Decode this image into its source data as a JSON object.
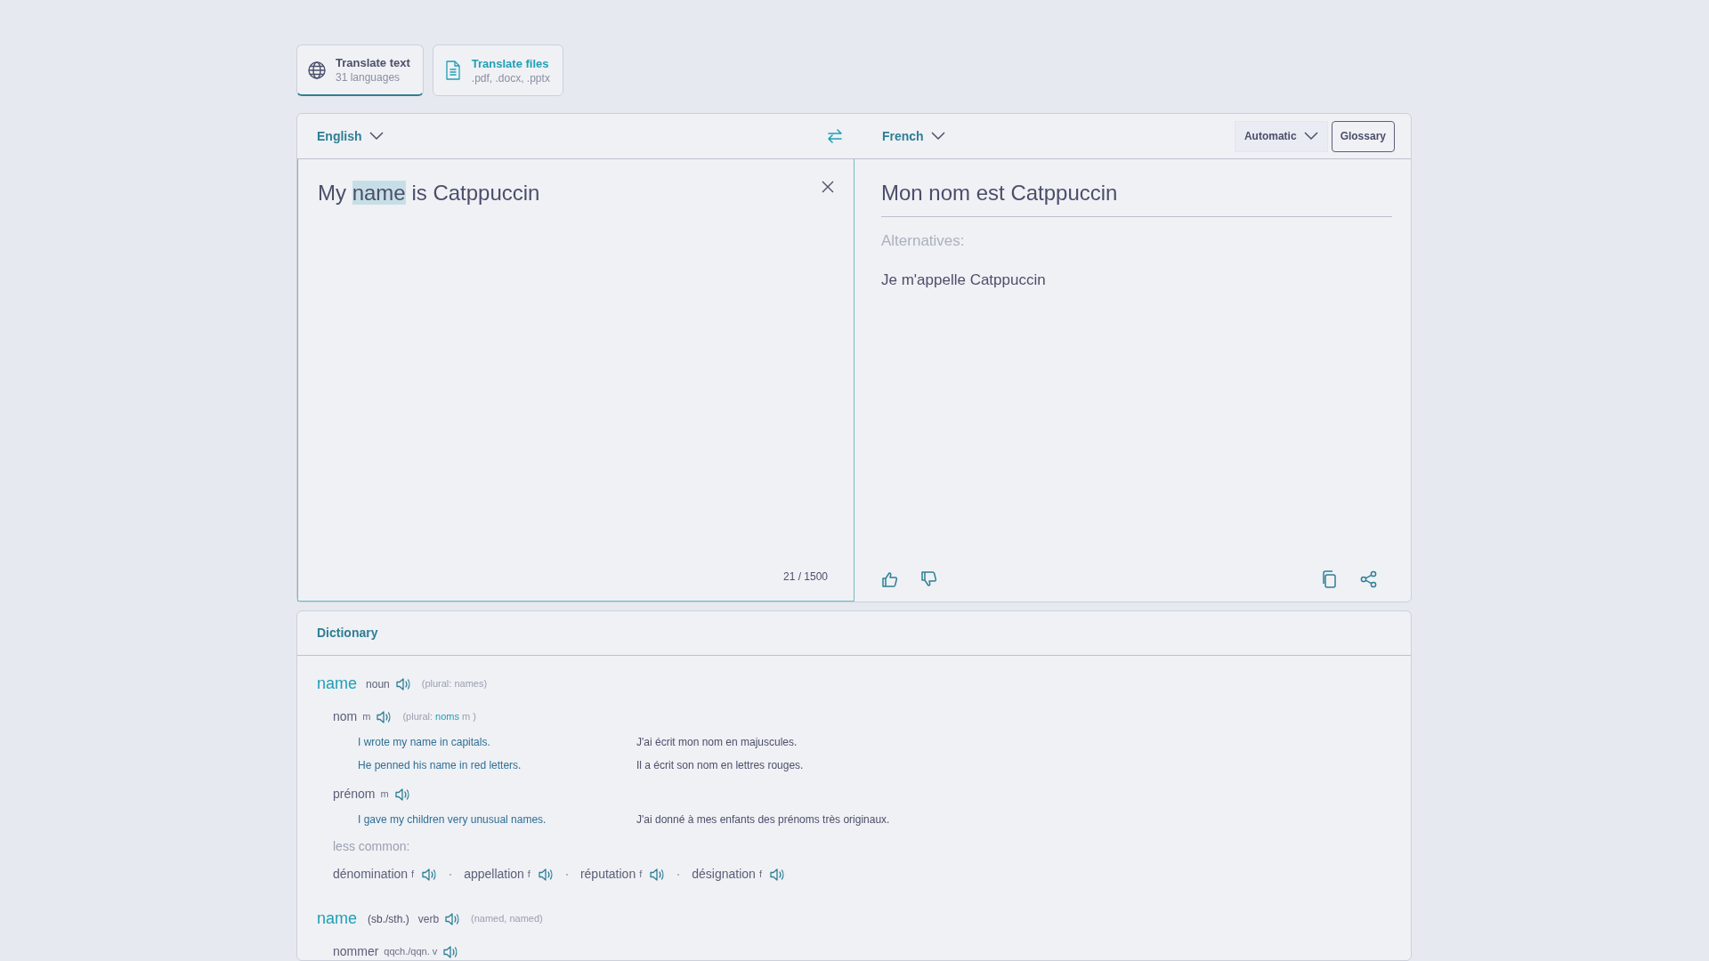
{
  "mode_tabs": [
    {
      "title": "Translate text",
      "subtitle": "31 languages",
      "selected": true
    },
    {
      "title": "Translate files",
      "subtitle": ".pdf, .docx, .pptx",
      "selected": false
    }
  ],
  "translator": {
    "source_language": "English",
    "target_language": "French",
    "formality": "Automatic",
    "glossary_button": "Glossary",
    "source": {
      "before": "My ",
      "highlight": "name",
      "after": " is Catppuccin"
    },
    "char_count": "21 / 1500",
    "translation": "Mon nom est Catppuccin",
    "alternatives_label": "Alternatives:",
    "alternatives": [
      "Je m'appelle Catppuccin"
    ]
  },
  "dictionary": {
    "title": "Dictionary",
    "entries": [
      {
        "headword": "name",
        "pos": "noun",
        "forms": "(plural: names)",
        "senses": [
          {
            "word": "nom",
            "gender": "m",
            "plural": {
              "before": "(plural:",
              "word": "noms",
              "after": "m )"
            },
            "examples": [
              {
                "source": "I wrote my name in capitals.",
                "target": "J'ai écrit mon nom en majuscules."
              },
              {
                "source": "He penned his name in red letters.",
                "target": "Il a écrit son nom en lettres rouges."
              }
            ]
          },
          {
            "word": "prénom",
            "gender": "m",
            "examples": [
              {
                "source": "I gave my children very unusual names.",
                "target": "J'ai donné à mes enfants des prénoms très originaux."
              }
            ]
          }
        ],
        "less_common": {
          "label": "less common:",
          "items": [
            {
              "word": "dénomination",
              "gender": "f"
            },
            {
              "word": "appellation",
              "gender": "f"
            },
            {
              "word": "réputation",
              "gender": "f"
            },
            {
              "word": "désignation",
              "gender": "f"
            }
          ]
        }
      },
      {
        "headword": "name",
        "qualifier": "(sb./sth.)",
        "pos": "verb",
        "forms": "(named, named)",
        "senses": [
          {
            "word": "nommer",
            "gender": "qqch./qqn. v"
          }
        ]
      }
    ]
  }
}
